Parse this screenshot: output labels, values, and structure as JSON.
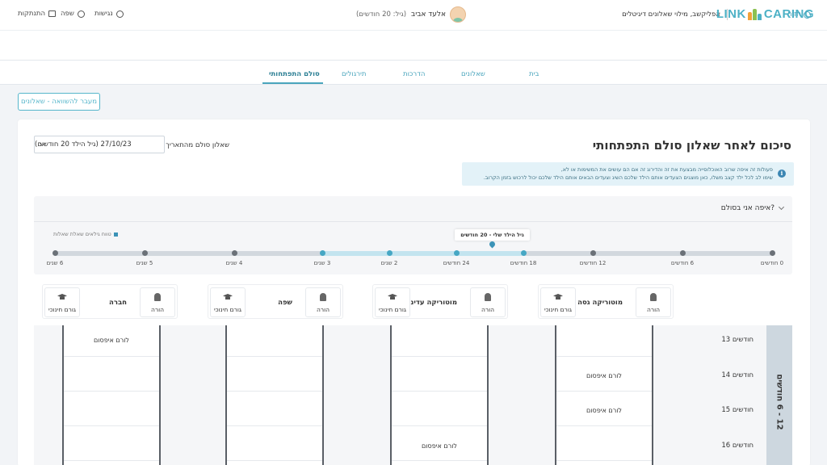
{
  "topbar": {
    "logo_link": "LINK",
    "logo_caring": "CARING",
    "tagline": "אפליקשב, מילוי שאלונים דיגיטלים",
    "accessibility": "נגישות",
    "language": "שפה",
    "logout": "התנתקות"
  },
  "userbar": {
    "back": "חזור",
    "child_name": "אלעד אביב",
    "child_age": "(גיל: 20 חודשים)"
  },
  "nav": {
    "tabs": [
      {
        "label": "בית"
      },
      {
        "label": "שאלונים"
      },
      {
        "label": "הדרכות"
      },
      {
        "label": "תירגולים"
      },
      {
        "label": "סולם התפתחותי"
      }
    ],
    "active_index": 4
  },
  "compare_button": "מעבר להשוואה - שאלונים",
  "summary": {
    "title": "סיכום לאחר שאלון סולם התפתחותי",
    "questionnaire_label": "שאלון סולם מהתאריך",
    "questionnaire_value": "27/10/23 (גיל הילד 20 חודשים)",
    "info_line1": "פעולות זה איפה שרוב האוכלוסייה מבצעת את זה והדירוג זה אם הם עושים את המשימות או לא,",
    "info_line2": "שימו לב לכל ילד קצב משלו, כאן מוצגים הצעדים אותם הילד שלכם השיג וצעדים הבאים אותם הילד שלכם יכול לרכוש בזמן הקרוב."
  },
  "where_am_i": {
    "heading": "איפה אני בסולם?",
    "legend": "טווח גילאים שאלת שאלות",
    "marker_label": "גיל הילד שלי - 20 חודשים",
    "ticks": [
      "0 חודשים",
      "6 חודשים",
      "12 חודשים",
      "18 חודשים",
      "24 חודשים",
      "2 שנים",
      "3 שנים",
      "4 שנים",
      "5 שנים",
      "6 שנים"
    ],
    "highlight_from_index": 3,
    "highlight_to_index": 6,
    "marker_months": 20
  },
  "areas": [
    {
      "name": "מוטוריקה גסה",
      "parent": "הורה",
      "educator": "גורם חינוכי"
    },
    {
      "name": "מוטוריקה עדינה",
      "parent": "הורה",
      "educator": "גורם חינוכי"
    },
    {
      "name": "שפה",
      "parent": "הורה",
      "educator": "גורם חינוכי"
    },
    {
      "name": "חברה",
      "parent": "הורה",
      "educator": "גורם חינוכי"
    }
  ],
  "grid": {
    "age_band": "12 - 6 חודשים",
    "months": [
      "13 חודשים",
      "14 חודשים",
      "15 חודשים",
      "16 חודשים"
    ],
    "cell_text": "לורם איפסום"
  },
  "colors": {
    "accent": "#4aa5bd",
    "track": "#d2d8de",
    "track_highlight": "#c3e4ef",
    "marker": "#3b93b7"
  }
}
